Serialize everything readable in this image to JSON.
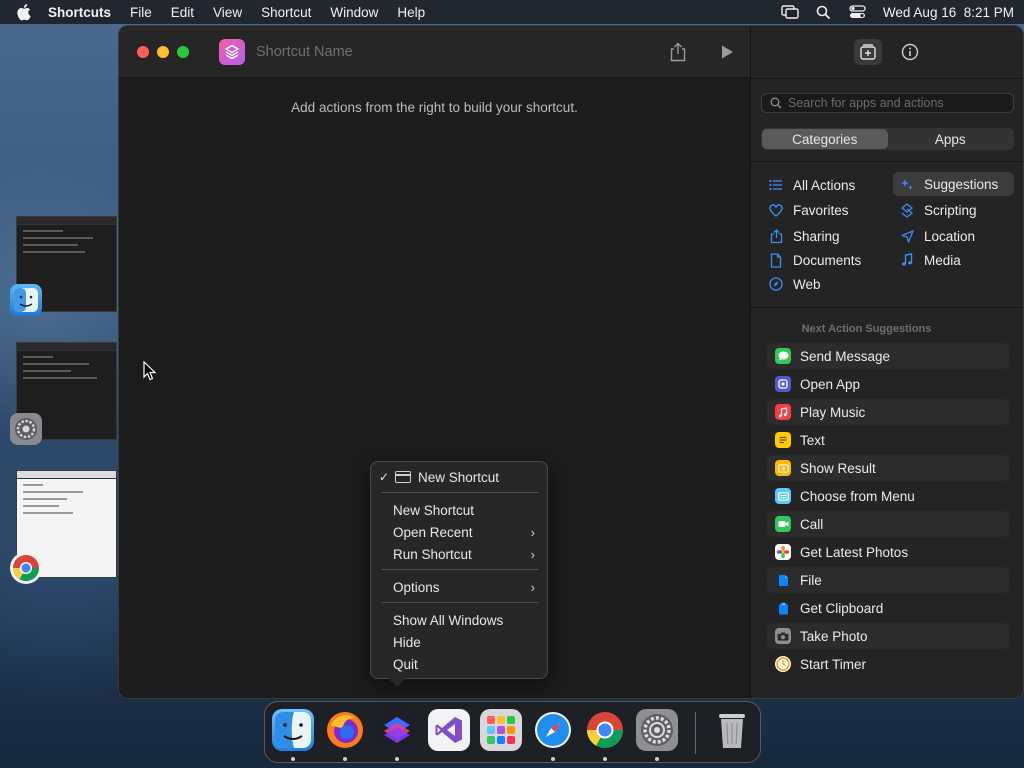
{
  "menubar": {
    "app_name": "Shortcuts",
    "items": [
      "File",
      "Edit",
      "View",
      "Shortcut",
      "Window",
      "Help"
    ],
    "datetime": "Wed Aug 16  8:21 PM",
    "status_icons": [
      "screen-mirroring-icon",
      "search-icon",
      "control-center-icon"
    ]
  },
  "editor": {
    "title_placeholder": "Shortcut Name",
    "empty_hint": "Add actions from the right to build your shortcut."
  },
  "library": {
    "search_placeholder": "Search for apps and actions",
    "segments": [
      "Categories",
      "Apps"
    ],
    "selected_segment": "Categories",
    "categories_left": [
      {
        "label": "All Actions",
        "icon": "list-icon"
      },
      {
        "label": "Favorites",
        "icon": "heart-icon"
      },
      {
        "label": "Sharing",
        "icon": "share-icon"
      },
      {
        "label": "Documents",
        "icon": "document-icon"
      },
      {
        "label": "Web",
        "icon": "compass-icon"
      }
    ],
    "categories_right": [
      {
        "label": "Suggestions",
        "icon": "sparkles-icon"
      },
      {
        "label": "Scripting",
        "icon": "scripting-icon"
      },
      {
        "label": "Location",
        "icon": "location-arrow-icon"
      },
      {
        "label": "Media",
        "icon": "music-note-icon"
      }
    ],
    "selected_category": "Suggestions",
    "suggestions_title": "Next Action Suggestions",
    "actions": [
      {
        "label": "Send Message",
        "icon": "messages-icon",
        "color": "#34c759"
      },
      {
        "label": "Open App",
        "icon": "open-app-icon",
        "color": "#5856d6"
      },
      {
        "label": "Play Music",
        "icon": "music-icon",
        "color": "#fc3c44"
      },
      {
        "label": "Text",
        "icon": "text-icon",
        "color": "#ffcc00"
      },
      {
        "label": "Show Result",
        "icon": "show-result-icon",
        "color": "#ffb800"
      },
      {
        "label": "Choose from Menu",
        "icon": "menu-icon",
        "color": "#5ac8fa"
      },
      {
        "label": "Call",
        "icon": "phone-icon",
        "color": "#34c759"
      },
      {
        "label": "Get Latest Photos",
        "icon": "photos-icon",
        "color": "#ff9500"
      },
      {
        "label": "File",
        "icon": "file-icon",
        "color": "#0a84ff"
      },
      {
        "label": "Get Clipboard",
        "icon": "clipboard-icon",
        "color": "#0a84ff"
      },
      {
        "label": "Take Photo",
        "icon": "camera-icon",
        "color": "#8e8e93"
      },
      {
        "label": "Start Timer",
        "icon": "timer-icon",
        "color": "#ff9500"
      }
    ]
  },
  "context_menu": {
    "window_item": "New Shortcut",
    "items": [
      {
        "label": "New Shortcut",
        "submenu": false
      },
      {
        "label": "Open Recent",
        "submenu": true
      },
      {
        "label": "Run Shortcut",
        "submenu": true
      },
      {
        "label": "Options",
        "submenu": true
      },
      {
        "label": "Show All Windows",
        "submenu": false
      },
      {
        "label": "Hide",
        "submenu": false
      },
      {
        "label": "Quit",
        "submenu": false
      }
    ]
  },
  "dock": {
    "apps": [
      {
        "name": "Finder",
        "icon": "finder-icon",
        "running": true
      },
      {
        "name": "Firefox",
        "icon": "firefox-icon",
        "running": true
      },
      {
        "name": "Shortcuts",
        "icon": "shortcuts-icon",
        "running": true
      },
      {
        "name": "Visual Studio",
        "icon": "visual-studio-icon",
        "running": false
      },
      {
        "name": "Launchpad",
        "icon": "launchpad-icon",
        "running": false
      },
      {
        "name": "Safari",
        "icon": "safari-icon",
        "running": true
      },
      {
        "name": "Chrome",
        "icon": "chrome-icon",
        "running": true
      },
      {
        "name": "System Settings",
        "icon": "settings-icon",
        "running": true
      },
      {
        "name": "Trash",
        "icon": "trash-icon",
        "running": false
      }
    ]
  },
  "colors": {
    "accent_blue": "#0a84ff",
    "shortcuts_pink": "#f25fa8",
    "shortcuts_purple": "#b55ef0"
  }
}
